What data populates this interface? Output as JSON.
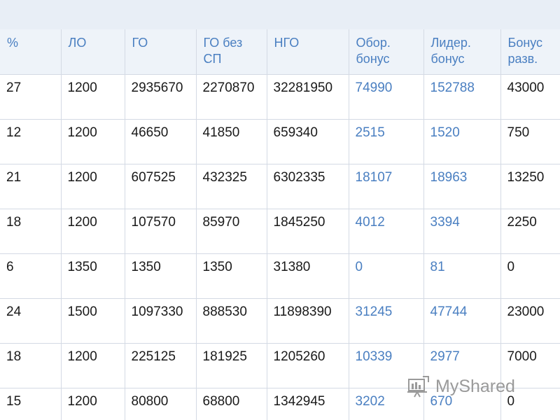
{
  "table": {
    "headers": [
      [
        "%"
      ],
      [
        "ЛО"
      ],
      [
        "ГО"
      ],
      [
        "ГО без",
        "СП"
      ],
      [
        "НГО"
      ],
      [
        "Обор.",
        "бонус"
      ],
      [
        "Лидер.",
        "бонус"
      ],
      [
        "Бонус",
        "разв."
      ]
    ],
    "blue_columns": [
      5,
      6
    ],
    "rows": [
      [
        "27",
        "1200",
        "2935670",
        "2270870",
        "32281950",
        "74990",
        "152788",
        "43000"
      ],
      [
        "12",
        "1200",
        "46650",
        "41850",
        "659340",
        "2515",
        "1520",
        "750"
      ],
      [
        "21",
        "1200",
        "607525",
        "432325",
        "6302335",
        "18107",
        "18963",
        "13250"
      ],
      [
        "18",
        "1200",
        "107570",
        "85970",
        "1845250",
        "4012",
        "3394",
        "2250"
      ],
      [
        "6",
        "1350",
        "1350",
        "1350",
        "31380",
        "0",
        "81",
        "0"
      ],
      [
        "24",
        "1500",
        "1097330",
        "888530",
        "11898390",
        "31245",
        "47744",
        "23000"
      ],
      [
        "18",
        "1200",
        "225125",
        "181925",
        "1205260",
        "10339",
        "2977",
        "7000"
      ],
      [
        "15",
        "1200",
        "80800",
        "68800",
        "1342945",
        "3202",
        "670",
        "0"
      ]
    ]
  },
  "watermark": {
    "text": "MyShared",
    "icon": "myshared-logo-icon",
    "color": "#9a9a9a"
  },
  "colors": {
    "header_text": "#4a7fc1",
    "link_text": "#4a7fc1",
    "body_text": "#1a1a1a",
    "header_bg": "#eef3f9",
    "grid": "#d4dae4"
  }
}
